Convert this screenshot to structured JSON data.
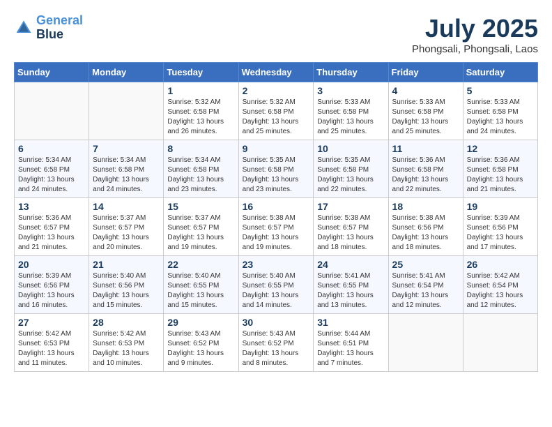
{
  "header": {
    "logo_line1": "General",
    "logo_line2": "Blue",
    "month_title": "July 2025",
    "location": "Phongsali, Phongsali, Laos"
  },
  "weekdays": [
    "Sunday",
    "Monday",
    "Tuesday",
    "Wednesday",
    "Thursday",
    "Friday",
    "Saturday"
  ],
  "weeks": [
    [
      {
        "day": "",
        "sunrise": "",
        "sunset": "",
        "daylight": ""
      },
      {
        "day": "",
        "sunrise": "",
        "sunset": "",
        "daylight": ""
      },
      {
        "day": "1",
        "sunrise": "Sunrise: 5:32 AM",
        "sunset": "Sunset: 6:58 PM",
        "daylight": "Daylight: 13 hours and 26 minutes."
      },
      {
        "day": "2",
        "sunrise": "Sunrise: 5:32 AM",
        "sunset": "Sunset: 6:58 PM",
        "daylight": "Daylight: 13 hours and 25 minutes."
      },
      {
        "day": "3",
        "sunrise": "Sunrise: 5:33 AM",
        "sunset": "Sunset: 6:58 PM",
        "daylight": "Daylight: 13 hours and 25 minutes."
      },
      {
        "day": "4",
        "sunrise": "Sunrise: 5:33 AM",
        "sunset": "Sunset: 6:58 PM",
        "daylight": "Daylight: 13 hours and 25 minutes."
      },
      {
        "day": "5",
        "sunrise": "Sunrise: 5:33 AM",
        "sunset": "Sunset: 6:58 PM",
        "daylight": "Daylight: 13 hours and 24 minutes."
      }
    ],
    [
      {
        "day": "6",
        "sunrise": "Sunrise: 5:34 AM",
        "sunset": "Sunset: 6:58 PM",
        "daylight": "Daylight: 13 hours and 24 minutes."
      },
      {
        "day": "7",
        "sunrise": "Sunrise: 5:34 AM",
        "sunset": "Sunset: 6:58 PM",
        "daylight": "Daylight: 13 hours and 24 minutes."
      },
      {
        "day": "8",
        "sunrise": "Sunrise: 5:34 AM",
        "sunset": "Sunset: 6:58 PM",
        "daylight": "Daylight: 13 hours and 23 minutes."
      },
      {
        "day": "9",
        "sunrise": "Sunrise: 5:35 AM",
        "sunset": "Sunset: 6:58 PM",
        "daylight": "Daylight: 13 hours and 23 minutes."
      },
      {
        "day": "10",
        "sunrise": "Sunrise: 5:35 AM",
        "sunset": "Sunset: 6:58 PM",
        "daylight": "Daylight: 13 hours and 22 minutes."
      },
      {
        "day": "11",
        "sunrise": "Sunrise: 5:36 AM",
        "sunset": "Sunset: 6:58 PM",
        "daylight": "Daylight: 13 hours and 22 minutes."
      },
      {
        "day": "12",
        "sunrise": "Sunrise: 5:36 AM",
        "sunset": "Sunset: 6:58 PM",
        "daylight": "Daylight: 13 hours and 21 minutes."
      }
    ],
    [
      {
        "day": "13",
        "sunrise": "Sunrise: 5:36 AM",
        "sunset": "Sunset: 6:57 PM",
        "daylight": "Daylight: 13 hours and 21 minutes."
      },
      {
        "day": "14",
        "sunrise": "Sunrise: 5:37 AM",
        "sunset": "Sunset: 6:57 PM",
        "daylight": "Daylight: 13 hours and 20 minutes."
      },
      {
        "day": "15",
        "sunrise": "Sunrise: 5:37 AM",
        "sunset": "Sunset: 6:57 PM",
        "daylight": "Daylight: 13 hours and 19 minutes."
      },
      {
        "day": "16",
        "sunrise": "Sunrise: 5:38 AM",
        "sunset": "Sunset: 6:57 PM",
        "daylight": "Daylight: 13 hours and 19 minutes."
      },
      {
        "day": "17",
        "sunrise": "Sunrise: 5:38 AM",
        "sunset": "Sunset: 6:57 PM",
        "daylight": "Daylight: 13 hours and 18 minutes."
      },
      {
        "day": "18",
        "sunrise": "Sunrise: 5:38 AM",
        "sunset": "Sunset: 6:56 PM",
        "daylight": "Daylight: 13 hours and 18 minutes."
      },
      {
        "day": "19",
        "sunrise": "Sunrise: 5:39 AM",
        "sunset": "Sunset: 6:56 PM",
        "daylight": "Daylight: 13 hours and 17 minutes."
      }
    ],
    [
      {
        "day": "20",
        "sunrise": "Sunrise: 5:39 AM",
        "sunset": "Sunset: 6:56 PM",
        "daylight": "Daylight: 13 hours and 16 minutes."
      },
      {
        "day": "21",
        "sunrise": "Sunrise: 5:40 AM",
        "sunset": "Sunset: 6:56 PM",
        "daylight": "Daylight: 13 hours and 15 minutes."
      },
      {
        "day": "22",
        "sunrise": "Sunrise: 5:40 AM",
        "sunset": "Sunset: 6:55 PM",
        "daylight": "Daylight: 13 hours and 15 minutes."
      },
      {
        "day": "23",
        "sunrise": "Sunrise: 5:40 AM",
        "sunset": "Sunset: 6:55 PM",
        "daylight": "Daylight: 13 hours and 14 minutes."
      },
      {
        "day": "24",
        "sunrise": "Sunrise: 5:41 AM",
        "sunset": "Sunset: 6:55 PM",
        "daylight": "Daylight: 13 hours and 13 minutes."
      },
      {
        "day": "25",
        "sunrise": "Sunrise: 5:41 AM",
        "sunset": "Sunset: 6:54 PM",
        "daylight": "Daylight: 13 hours and 12 minutes."
      },
      {
        "day": "26",
        "sunrise": "Sunrise: 5:42 AM",
        "sunset": "Sunset: 6:54 PM",
        "daylight": "Daylight: 13 hours and 12 minutes."
      }
    ],
    [
      {
        "day": "27",
        "sunrise": "Sunrise: 5:42 AM",
        "sunset": "Sunset: 6:53 PM",
        "daylight": "Daylight: 13 hours and 11 minutes."
      },
      {
        "day": "28",
        "sunrise": "Sunrise: 5:42 AM",
        "sunset": "Sunset: 6:53 PM",
        "daylight": "Daylight: 13 hours and 10 minutes."
      },
      {
        "day": "29",
        "sunrise": "Sunrise: 5:43 AM",
        "sunset": "Sunset: 6:52 PM",
        "daylight": "Daylight: 13 hours and 9 minutes."
      },
      {
        "day": "30",
        "sunrise": "Sunrise: 5:43 AM",
        "sunset": "Sunset: 6:52 PM",
        "daylight": "Daylight: 13 hours and 8 minutes."
      },
      {
        "day": "31",
        "sunrise": "Sunrise: 5:44 AM",
        "sunset": "Sunset: 6:51 PM",
        "daylight": "Daylight: 13 hours and 7 minutes."
      },
      {
        "day": "",
        "sunrise": "",
        "sunset": "",
        "daylight": ""
      },
      {
        "day": "",
        "sunrise": "",
        "sunset": "",
        "daylight": ""
      }
    ]
  ]
}
